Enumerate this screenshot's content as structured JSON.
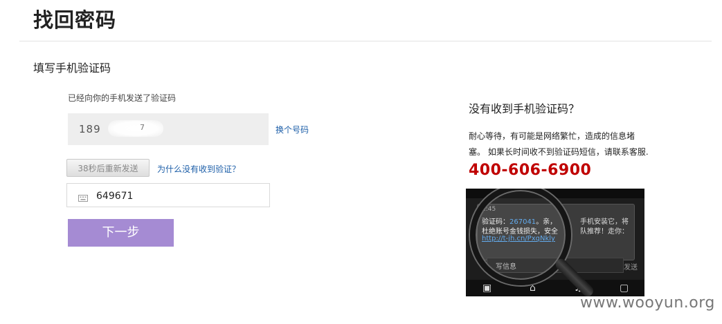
{
  "header": {
    "title": "找回密码"
  },
  "section": {
    "title": "填写手机验证码"
  },
  "form": {
    "sent_notice": "已经向你的手机发送了验证码",
    "phone_partial": "189",
    "phone_tail": "7",
    "change_number_label": "换个号码",
    "resend_label": "38秒后重新发送",
    "why_label": "为什么没有收到验证？",
    "code_value": "649671",
    "next_label": "下一步"
  },
  "help": {
    "title": "没有收到手机验证码？",
    "line1": "耐心等待，有可能是网络繁忙，造成的信息堵",
    "line2": "塞。 如果长时间收不到验证码短信，请联系客服.",
    "hotline": "400-606-6900"
  },
  "screenshot": {
    "time": "1:45",
    "line1_prefix": "验证码：",
    "line1_code": "267041",
    "line1_suffix": "。亲，",
    "line2": "杜绝账号金钱损失，安全",
    "line3": "http://t-jh.cn/PxqNkly",
    "right1": "手机安装它，将",
    "right2": "队推荐！走你：",
    "compose": "写信息",
    "send": "发送"
  },
  "watermark": "www.wooyun.org",
  "colors": {
    "next_button": "#a58bd3",
    "hotline": "#c00000",
    "link": "#1c5ea8"
  }
}
